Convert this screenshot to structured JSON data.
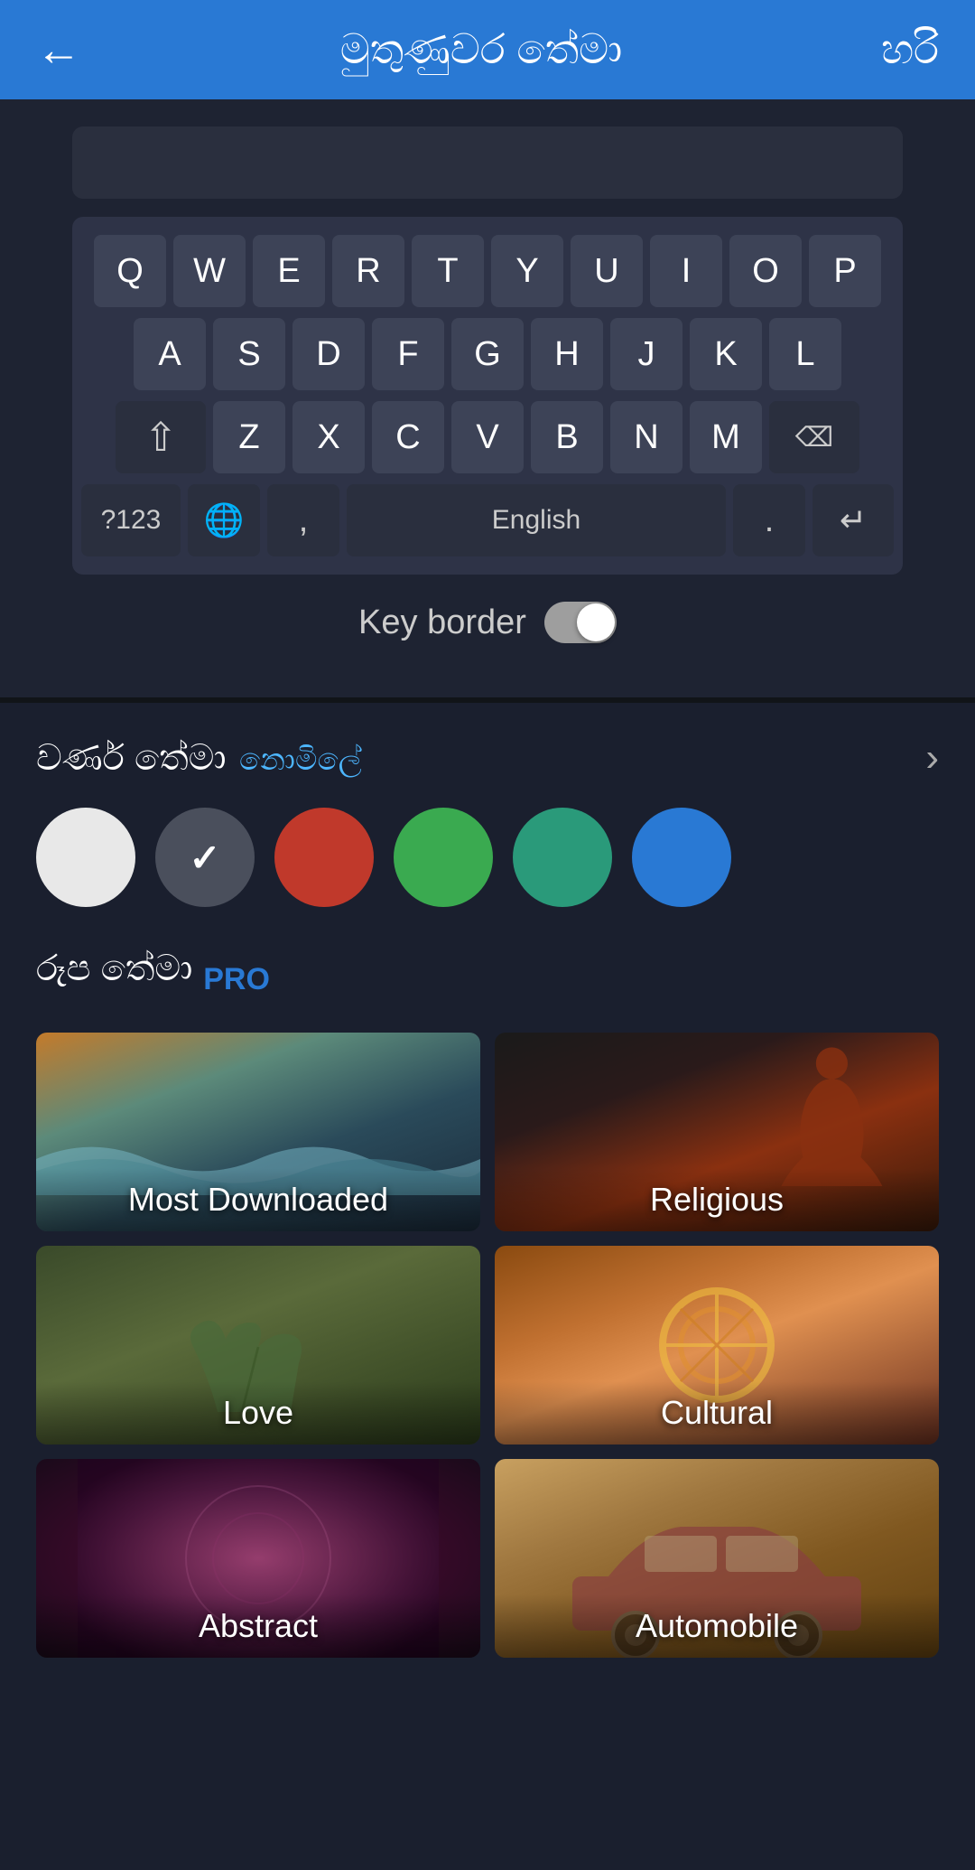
{
  "header": {
    "back_icon": "←",
    "title": "මුතුණුවර තේමා",
    "ok_label": "හරි"
  },
  "keyboard": {
    "rows": [
      [
        "Q",
        "W",
        "E",
        "R",
        "T",
        "Y",
        "U",
        "I",
        "O",
        "P"
      ],
      [
        "A",
        "S",
        "D",
        "F",
        "G",
        "H",
        "J",
        "K",
        "L"
      ],
      [
        "Z",
        "X",
        "C",
        "V",
        "B",
        "N",
        "M"
      ]
    ],
    "space_label": "English"
  },
  "key_border": {
    "label": "Key border"
  },
  "color_theme": {
    "label": "වර්ණ තේමා",
    "sub_label": "නොමිලේ",
    "colors": [
      {
        "id": "white",
        "hex": "#e8e8e8",
        "selected": false
      },
      {
        "id": "dark-gray",
        "hex": "#4a4f5c",
        "selected": true
      },
      {
        "id": "red",
        "hex": "#c0392b",
        "selected": false
      },
      {
        "id": "green",
        "hex": "#3aaa50",
        "selected": false
      },
      {
        "id": "teal",
        "hex": "#2a9a7a",
        "selected": false
      },
      {
        "id": "blue",
        "hex": "#2979d4",
        "selected": false
      }
    ]
  },
  "image_theme": {
    "label": "රූප තේමා",
    "pro_label": "PRO",
    "cards": [
      {
        "id": "most-downloaded",
        "label": "Most Downloaded",
        "bg_class": "bg-most-downloaded"
      },
      {
        "id": "religious",
        "label": "Religious",
        "bg_class": "bg-religious"
      },
      {
        "id": "love",
        "label": "Love",
        "bg_class": "bg-love"
      },
      {
        "id": "cultural",
        "label": "Cultural",
        "bg_class": "bg-cultural"
      },
      {
        "id": "abstract",
        "label": "Abstract",
        "bg_class": "bg-abstract"
      },
      {
        "id": "automobile",
        "label": "Automobile",
        "bg_class": "bg-automobile"
      }
    ]
  }
}
